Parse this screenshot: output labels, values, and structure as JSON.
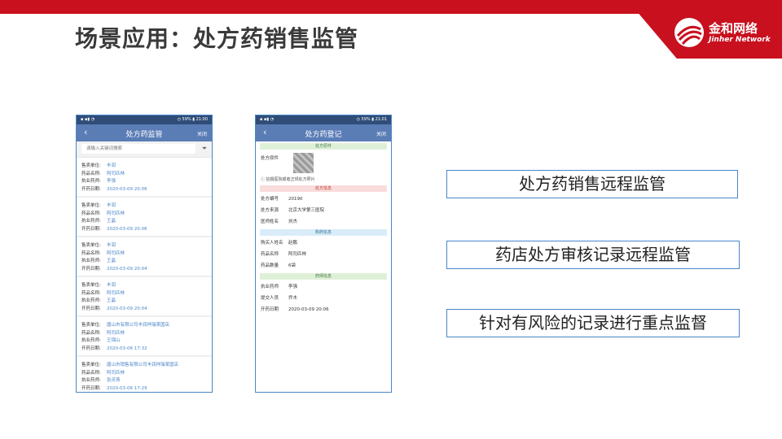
{
  "header": {
    "title": "场景应用：处方药销售监管",
    "brand_cn": "金和网络",
    "brand_en": "Jinher Network",
    "brand_color": "#c8101e"
  },
  "phone1": {
    "status_left": "▪ ▪▮ ◔",
    "status_right": "◷ 59% ▮ 21:00",
    "title": "处方药监管",
    "back": "‹",
    "close": "关闭",
    "search_placeholder": "请输入关键词搜索",
    "labels": {
      "seller": "售卖单位:",
      "drug": "药品名称:",
      "pharmacist": "执业药师:",
      "date": "开药日期:"
    },
    "records": [
      {
        "seller": "丰润",
        "drug": "阿司匹林",
        "pharmacist": "李强",
        "date": "2020-03-09 20:06"
      },
      {
        "seller": "丰润",
        "drug": "阿司匹林",
        "pharmacist": "王晶",
        "date": "2020-03-09 20:06"
      },
      {
        "seller": "丰润",
        "drug": "阿司匹林",
        "pharmacist": "王晶",
        "date": "2020-03-09 20:04"
      },
      {
        "seller": "丰润",
        "drug": "阿司匹林",
        "pharmacist": "王晶",
        "date": "2020-03-09 20:04"
      },
      {
        "seller": "唐山市有限公司丰润祥瑞某国店",
        "drug": "阿司匹林",
        "pharmacist": "王锦山",
        "date": "2020-03-06 17:32"
      },
      {
        "seller": "唐山市销售有限公司丰润祥瑞某国店",
        "drug": "阿司匹林",
        "pharmacist": "张灵燕",
        "date": "2020-03-06 17:29"
      }
    ]
  },
  "phone2": {
    "status_left": "▪ ▪▮ ◔",
    "status_right": "◷ 59% ▮ 21:01",
    "title": "处方药登记",
    "back": "‹",
    "close": "关闭",
    "sections": {
      "rx": "处方原件",
      "rx_info": "处方信息",
      "buy_info": "购药信息",
      "pharm_info": "药师信息"
    },
    "rx_label": "处方原件",
    "hint": "ⓘ 拍摄医院或者正规处方照片",
    "rx_fields": [
      {
        "label": "处方编号",
        "value": "20190"
      },
      {
        "label": "处方来源",
        "value": "北京大学第三医院"
      },
      {
        "label": "医师姓名",
        "value": "刘杰"
      }
    ],
    "buy_fields": [
      {
        "label": "购买人姓名",
        "value": "赵鹏"
      },
      {
        "label": "药品名称",
        "value": "阿司匹林"
      },
      {
        "label": "药品数量",
        "value": "6袋"
      }
    ],
    "pharm_fields": [
      {
        "label": "执业药师",
        "value": "李强"
      },
      {
        "label": "提交人员",
        "value": "乔木"
      },
      {
        "label": "开药日期",
        "value": "2020-03-09 20:06"
      }
    ]
  },
  "features": [
    "处方药销售远程监管",
    "药店处方审核记录远程监管",
    "针对有风险的记录进行重点监督"
  ]
}
